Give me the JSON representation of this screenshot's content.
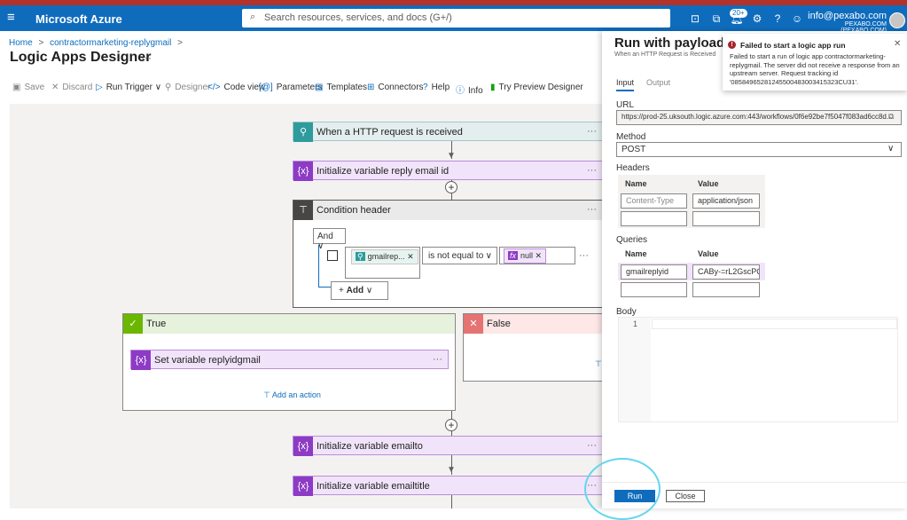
{
  "header": {
    "brand": "Microsoft Azure",
    "search_placeholder": "Search resources, services, and docs (G+/)",
    "badge": "20+",
    "account_email": "info@pexabo.com",
    "account_org": "PEXABO.COM (PEXABO.COM)"
  },
  "breadcrumb": {
    "home": "Home",
    "sep": ">",
    "resource": "contractormarketing-replygmail",
    "sep2": ">"
  },
  "page": {
    "title": "Logic Apps Designer",
    "more": "···"
  },
  "toolbar": {
    "save": "Save",
    "discard": "Discard",
    "run_trigger": "Run Trigger",
    "designer": "Designer",
    "code_view": "Code view",
    "parameters": "Parameters",
    "templates": "Templates",
    "connectors": "Connectors",
    "help": "Help",
    "info": "Info",
    "try_preview": "Try Preview Designer"
  },
  "canvas": {
    "http_trigger": "When a HTTP request is received",
    "init_reply": "Initialize variable reply email id",
    "condition": "Condition header",
    "and_label": "And",
    "token1": "gmailrep...",
    "operator": "is not equal to",
    "token2": "null",
    "add_label": "Add",
    "true_label": "True",
    "false_label": "False",
    "set_var": "Set variable replyidgmail",
    "add_action": "Add an action",
    "init_emailto": "Initialize variable emailto",
    "init_emailtitle": "Initialize variable emailtitle",
    "more": "···"
  },
  "panel": {
    "title": "Run with payload",
    "subtitle": "When an HTTP Request is Received",
    "tab_input": "Input",
    "tab_output": "Output",
    "url_label": "URL",
    "url_value": "https://prod-25.uksouth.logic.azure.com:443/workflows/0f6e92be7f5047f083ad6cc8d...",
    "method_label": "Method",
    "method_value": "POST",
    "headers_label": "Headers",
    "name_col": "Name",
    "value_col": "Value",
    "header_name_placeholder": "Content-Type",
    "header_value": "application/json",
    "queries_label": "Queries",
    "query_name": "gmailreplyid",
    "query_value": "CABy-=rL2GscPQ...",
    "body_label": "Body",
    "line_no": "1",
    "run": "Run",
    "close": "Close"
  },
  "toast": {
    "title": "Failed to start a logic app run",
    "message": "Failed to start a run of logic app contractormarketing-replygmail. The server did not receive a response from an upstream server. Request tracking id '08584965281245500483003415323CU31'."
  },
  "colors": {
    "azure_blue": "#0f6cbd",
    "variable_purple": "#8d3bc5",
    "http_teal": "#2e9b9c",
    "true_green": "#6bb700",
    "false_red": "#e57373",
    "error_red": "#a4262c"
  }
}
